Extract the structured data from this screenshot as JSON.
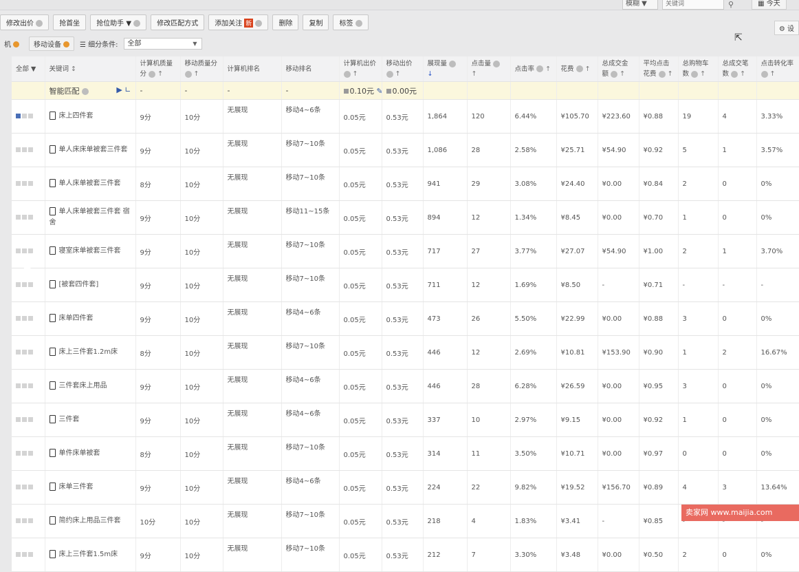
{
  "search": {
    "mode": "模糊",
    "placeholder": "关键词",
    "period": "今天"
  },
  "toolbar": {
    "items": [
      "修改出价",
      "抢首坐",
      "抢位助手",
      "修改匹配方式",
      "添加关注",
      "删除",
      "复制",
      "标签"
    ],
    "new_badge": "新"
  },
  "gear": "设",
  "filters": {
    "left": "机",
    "mobile": "移动设备",
    "segment_label": "细分条件:",
    "segment_value": "全部"
  },
  "headers": [
    "全部",
    "关键词",
    "计算机质量分",
    "移动质量分",
    "计算机排名",
    "移动排名",
    "计算机出价",
    "移动出价",
    "展现量",
    "点击量",
    "点击率",
    "花费",
    "总成交金额",
    "平均点击花费",
    "总购物车数",
    "总成交笔数",
    "点击转化率"
  ],
  "smart": {
    "label": "智能匹配",
    "pc_bid": "0.10元",
    "mobile_bid": "0.00元",
    "dash": "-"
  },
  "rows": [
    {
      "kw": "床上四件套",
      "pc": "9分",
      "mb": "10分",
      "pr": "无展现",
      "mr": "移动4~6条",
      "pb": "0.05元",
      "mbid": "0.53元",
      "imp": "1,864",
      "clk": "120",
      "ctr": "6.44%",
      "cost": "¥105.70",
      "gmv": "¥223.60",
      "cpc": "¥0.88",
      "cart": "19",
      "orders": "4",
      "cvr": "3.33%"
    },
    {
      "kw": "单人床床单被套三件套",
      "pc": "9分",
      "mb": "10分",
      "pr": "无展现",
      "mr": "移动7~10条",
      "pb": "0.05元",
      "mbid": "0.53元",
      "imp": "1,086",
      "clk": "28",
      "ctr": "2.58%",
      "cost": "¥25.71",
      "gmv": "¥54.90",
      "cpc": "¥0.92",
      "cart": "5",
      "orders": "1",
      "cvr": "3.57%"
    },
    {
      "kw": "单人床单被套三件套",
      "pc": "8分",
      "mb": "10分",
      "pr": "无展现",
      "mr": "移动7~10条",
      "pb": "0.05元",
      "mbid": "0.53元",
      "imp": "941",
      "clk": "29",
      "ctr": "3.08%",
      "cost": "¥24.40",
      "gmv": "¥0.00",
      "cpc": "¥0.84",
      "cart": "2",
      "orders": "0",
      "cvr": "0%"
    },
    {
      "kw": "单人床单被套三件套 宿舍",
      "pc": "9分",
      "mb": "10分",
      "pr": "无展现",
      "mr": "移动11~15条",
      "pb": "0.05元",
      "mbid": "0.53元",
      "imp": "894",
      "clk": "12",
      "ctr": "1.34%",
      "cost": "¥8.45",
      "gmv": "¥0.00",
      "cpc": "¥0.70",
      "cart": "1",
      "orders": "0",
      "cvr": "0%"
    },
    {
      "kw": "寝室床单被套三件套",
      "pc": "9分",
      "mb": "10分",
      "pr": "无展现",
      "mr": "移动7~10条",
      "pb": "0.05元",
      "mbid": "0.53元",
      "imp": "717",
      "clk": "27",
      "ctr": "3.77%",
      "cost": "¥27.07",
      "gmv": "¥54.90",
      "cpc": "¥1.00",
      "cart": "2",
      "orders": "1",
      "cvr": "3.70%"
    },
    {
      "kw": "[被套四件套]",
      "pc": "9分",
      "mb": "10分",
      "pr": "无展现",
      "mr": "移动7~10条",
      "pb": "0.05元",
      "mbid": "0.53元",
      "imp": "711",
      "clk": "12",
      "ctr": "1.69%",
      "cost": "¥8.50",
      "gmv": "-",
      "cpc": "¥0.71",
      "cart": "-",
      "orders": "-",
      "cvr": "-"
    },
    {
      "kw": "床单四件套",
      "pc": "9分",
      "mb": "10分",
      "pr": "无展现",
      "mr": "移动4~6条",
      "pb": "0.05元",
      "mbid": "0.53元",
      "imp": "473",
      "clk": "26",
      "ctr": "5.50%",
      "cost": "¥22.99",
      "gmv": "¥0.00",
      "cpc": "¥0.88",
      "cart": "3",
      "orders": "0",
      "cvr": "0%"
    },
    {
      "kw": "床上三件套1.2m床",
      "pc": "8分",
      "mb": "10分",
      "pr": "无展现",
      "mr": "移动7~10条",
      "pb": "0.05元",
      "mbid": "0.53元",
      "imp": "446",
      "clk": "12",
      "ctr": "2.69%",
      "cost": "¥10.81",
      "gmv": "¥153.90",
      "cpc": "¥0.90",
      "cart": "1",
      "orders": "2",
      "cvr": "16.67%"
    },
    {
      "kw": "三件套床上用品",
      "pc": "9分",
      "mb": "10分",
      "pr": "无展现",
      "mr": "移动4~6条",
      "pb": "0.05元",
      "mbid": "0.53元",
      "imp": "446",
      "clk": "28",
      "ctr": "6.28%",
      "cost": "¥26.59",
      "gmv": "¥0.00",
      "cpc": "¥0.95",
      "cart": "3",
      "orders": "0",
      "cvr": "0%"
    },
    {
      "kw": "三件套",
      "pc": "9分",
      "mb": "10分",
      "pr": "无展现",
      "mr": "移动4~6条",
      "pb": "0.05元",
      "mbid": "0.53元",
      "imp": "337",
      "clk": "10",
      "ctr": "2.97%",
      "cost": "¥9.15",
      "gmv": "¥0.00",
      "cpc": "¥0.92",
      "cart": "1",
      "orders": "0",
      "cvr": "0%"
    },
    {
      "kw": "单件床单被套",
      "pc": "8分",
      "mb": "10分",
      "pr": "无展现",
      "mr": "移动7~10条",
      "pb": "0.05元",
      "mbid": "0.53元",
      "imp": "314",
      "clk": "11",
      "ctr": "3.50%",
      "cost": "¥10.71",
      "gmv": "¥0.00",
      "cpc": "¥0.97",
      "cart": "0",
      "orders": "0",
      "cvr": "0%"
    },
    {
      "kw": "床单三件套",
      "pc": "9分",
      "mb": "10分",
      "pr": "无展现",
      "mr": "移动4~6条",
      "pb": "0.05元",
      "mbid": "0.53元",
      "imp": "224",
      "clk": "22",
      "ctr": "9.82%",
      "cost": "¥19.52",
      "gmv": "¥156.70",
      "cpc": "¥0.89",
      "cart": "4",
      "orders": "3",
      "cvr": "13.64%"
    },
    {
      "kw": "简约床上用品三件套",
      "pc": "10分",
      "mb": "10分",
      "pr": "无展现",
      "mr": "移动7~10条",
      "pb": "0.05元",
      "mbid": "0.53元",
      "imp": "218",
      "clk": "4",
      "ctr": "1.83%",
      "cost": "¥3.41",
      "gmv": "-",
      "cpc": "¥0.85",
      "cart": "-",
      "orders": "-",
      "cvr": "-"
    },
    {
      "kw": "床上三件套1.5m床",
      "pc": "9分",
      "mb": "10分",
      "pr": "无展现",
      "mr": "移动7~10条",
      "pb": "0.05元",
      "mbid": "0.53元",
      "imp": "212",
      "clk": "7",
      "ctr": "3.30%",
      "cost": "¥3.48",
      "gmv": "¥0.00",
      "cpc": "¥0.50",
      "cart": "2",
      "orders": "0",
      "cvr": "0%"
    }
  ],
  "watermark": "卖家网  www.maijia.com"
}
